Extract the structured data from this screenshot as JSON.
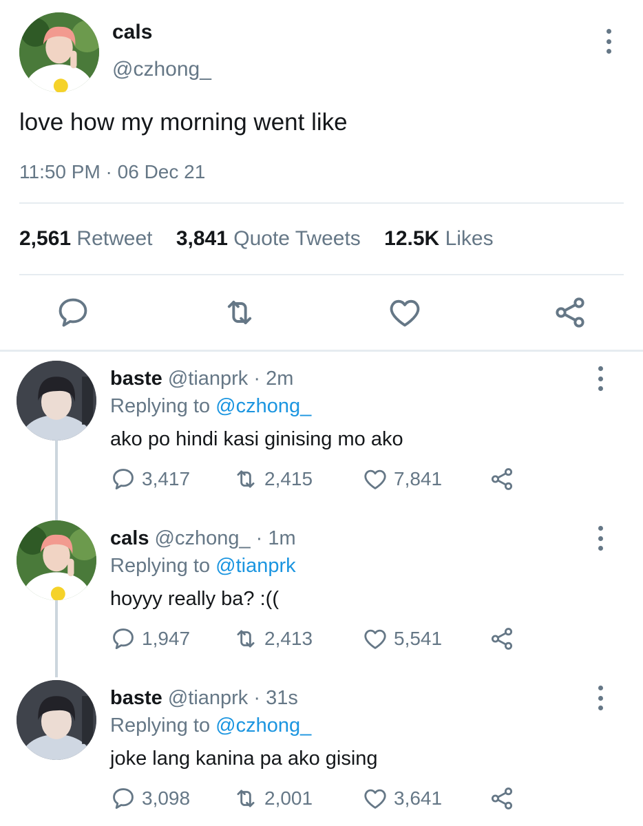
{
  "main_tweet": {
    "display_name": "cals",
    "handle": "@czhong_",
    "text": "love how my morning went like",
    "timestamp": "11:50 PM · 06 Dec 21",
    "stats": {
      "retweets_count": "2,561",
      "retweets_label": "Retweet",
      "quotes_count": "3,841",
      "quotes_label": "Quote Tweets",
      "likes_count": "12.5K",
      "likes_label": "Likes"
    },
    "actions": [
      "reply-icon",
      "retweet-icon",
      "like-icon",
      "share-icon"
    ]
  },
  "replies": [
    {
      "display_name": "baste",
      "handle": "@tianprk",
      "time": "· 2m",
      "replying_prefix": "Replying to",
      "replying_to": "@czhong_",
      "text": "ako po hindi kasi ginising mo ako",
      "reply_count": "3,417",
      "retweet_count": "2,415",
      "like_count": "7,841"
    },
    {
      "display_name": "cals",
      "handle": "@czhong_",
      "time": "· 1m",
      "replying_prefix": "Replying to",
      "replying_to": "@tianprk",
      "text": "hoyyy really ba? :((",
      "reply_count": "1,947",
      "retweet_count": "2,413",
      "like_count": "5,541"
    },
    {
      "display_name": "baste",
      "handle": "@tianprk",
      "time": "· 31s",
      "replying_prefix": "Replying to",
      "replying_to": "@czhong_",
      "text": "joke lang kanina pa ako gising",
      "reply_count": "3,098",
      "retweet_count": "2,001",
      "like_count": "3,641"
    }
  ],
  "colors": {
    "text_primary": "#14171a",
    "text_secondary": "#657786",
    "link": "#1b95e0",
    "divider": "#e6ecf0"
  }
}
